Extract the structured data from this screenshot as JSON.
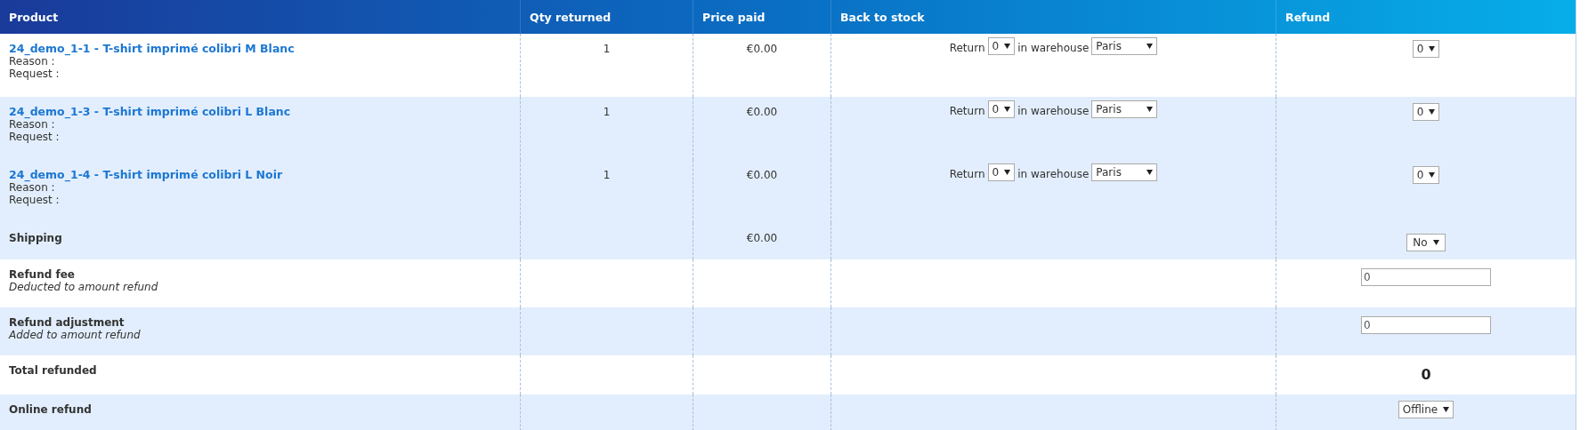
{
  "columns": [
    "Product",
    "Qty returned",
    "Price paid",
    "Back to stock",
    "Refund"
  ],
  "rows": [
    {
      "kind": "product",
      "highlighted": false,
      "name": "24_demo_1-1 - T-shirt imprimé colibri M Blanc",
      "reason": "Reason :",
      "request": "Request :",
      "qty": "1",
      "price": "€0.00",
      "return_label": "Return",
      "return_qty": "0",
      "warehouse_label": "in warehouse",
      "warehouse": "Paris",
      "refund": "0"
    },
    {
      "kind": "product",
      "highlighted": true,
      "name": "24_demo_1-3 - T-shirt imprimé colibri L Blanc",
      "reason": "Reason :",
      "request": "Request :",
      "qty": "1",
      "price": "€0.00",
      "return_label": "Return",
      "return_qty": "0",
      "warehouse_label": "in warehouse",
      "warehouse": "Paris",
      "refund": "0"
    },
    {
      "kind": "product",
      "highlighted": true,
      "name": "24_demo_1-4 - T-shirt imprimé colibri L Noir",
      "reason": "Reason :",
      "request": "Request :",
      "qty": "1",
      "price": "€0.00",
      "return_label": "Return",
      "return_qty": "0",
      "warehouse_label": "in warehouse",
      "warehouse": "Paris",
      "refund": "0"
    },
    {
      "kind": "shipping",
      "highlighted": true,
      "label": "Shipping",
      "price": "€0.00",
      "refund": "No"
    },
    {
      "kind": "input",
      "highlighted": false,
      "label": "Refund fee",
      "note": "Deducted to amount refund",
      "value": "0"
    },
    {
      "kind": "input",
      "highlighted": true,
      "label": "Refund adjustment",
      "note": "Added to amount refund",
      "value": "0"
    },
    {
      "kind": "total",
      "highlighted": false,
      "label": "Total refunded",
      "total": "0"
    },
    {
      "kind": "select",
      "highlighted": true,
      "label": "Online refund",
      "refund": "Offline"
    }
  ]
}
